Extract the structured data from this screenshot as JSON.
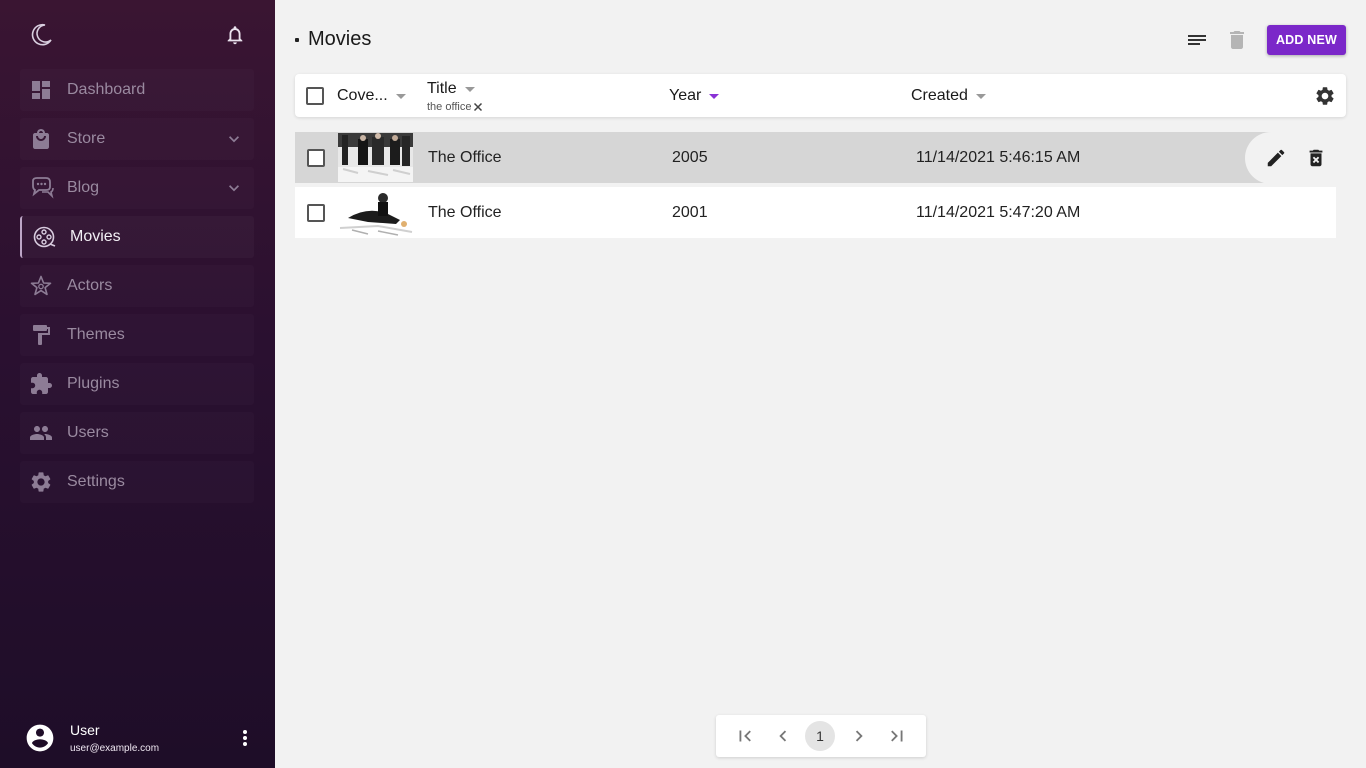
{
  "sidebar": {
    "items": [
      {
        "label": "Dashboard",
        "icon": "dashboard-icon"
      },
      {
        "label": "Store",
        "icon": "shopping-bag-icon",
        "expandable": true
      },
      {
        "label": "Blog",
        "icon": "chat-bubbles-icon",
        "expandable": true
      },
      {
        "label": "Movies",
        "icon": "film-reel-icon",
        "active": true
      },
      {
        "label": "Actors",
        "icon": "star-icon"
      },
      {
        "label": "Themes",
        "icon": "paint-roller-icon"
      },
      {
        "label": "Plugins",
        "icon": "puzzle-icon"
      },
      {
        "label": "Users",
        "icon": "users-icon"
      },
      {
        "label": "Settings",
        "icon": "gear-icon"
      }
    ],
    "user": {
      "name": "User",
      "email": "user@example.com"
    }
  },
  "page": {
    "title": "Movies",
    "add_label": "ADD NEW"
  },
  "table": {
    "columns": {
      "cover": "Cove...",
      "title": "Title",
      "year": "Year",
      "created": "Created"
    },
    "title_filter": "the office",
    "sorted_column": "Year",
    "rows": [
      {
        "title": "The Office",
        "year": "2005",
        "created": "11/14/2021 5:46:15 AM"
      },
      {
        "title": "The Office",
        "year": "2001",
        "created": "11/14/2021 5:47:20 AM"
      }
    ]
  },
  "pagination": {
    "current_page": "1"
  },
  "colors": {
    "accent": "#7b28c9",
    "sidebar_top": "#3a1532",
    "sidebar_bottom": "#1e0d28"
  }
}
